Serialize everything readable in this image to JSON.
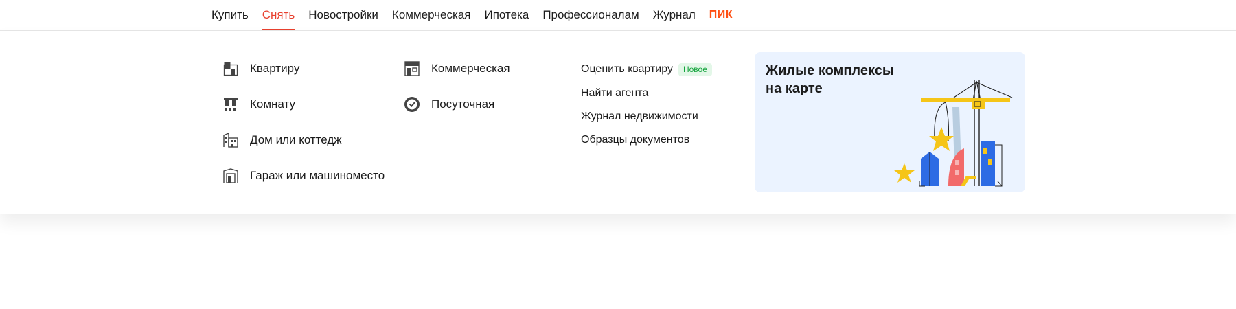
{
  "nav": {
    "items": [
      {
        "label": "Купить"
      },
      {
        "label": "Снять"
      },
      {
        "label": "Новостройки"
      },
      {
        "label": "Коммерческая"
      },
      {
        "label": "Ипотека"
      },
      {
        "label": "Профессионалам"
      },
      {
        "label": "Журнал"
      }
    ],
    "active_index": 1,
    "brand": "ПИК"
  },
  "rent_menu": {
    "residential": [
      {
        "label": "Квартиру",
        "icon": "apartment-icon"
      },
      {
        "label": "Комнату",
        "icon": "room-icon"
      },
      {
        "label": "Дом или коттедж",
        "icon": "house-icon"
      },
      {
        "label": "Гараж или машиноместо",
        "icon": "garage-icon"
      }
    ],
    "other": [
      {
        "label": "Коммерческая",
        "icon": "commercial-icon"
      },
      {
        "label": "Посуточная",
        "icon": "clock-icon"
      }
    ],
    "links": [
      {
        "label": "Оценить квартиру",
        "badge": "Новое"
      },
      {
        "label": "Найти агента"
      },
      {
        "label": "Журнал недвижимости"
      },
      {
        "label": "Образцы документов"
      }
    ]
  },
  "promo": {
    "title": "Жилые комплексы\nна карте"
  },
  "colors": {
    "accent": "#e8412f",
    "brand": "#ff4f12",
    "badge_text": "#12a33b",
    "badge_bg": "#e3f7e8",
    "promo_bg": "#ebf3ff"
  }
}
